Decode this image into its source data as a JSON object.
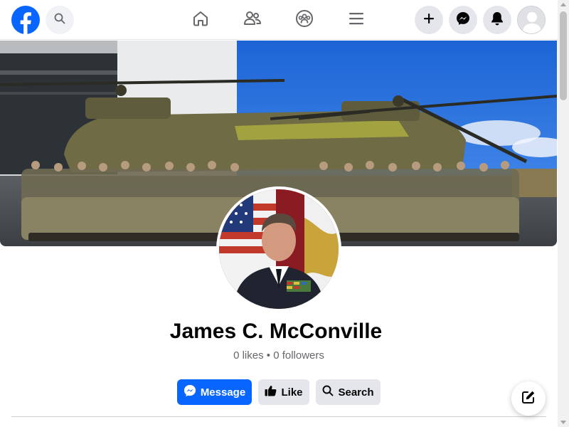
{
  "header": {
    "logo_icon": "facebook-logo-icon",
    "search_icon": "search-icon",
    "nav": [
      {
        "icon": "home-icon"
      },
      {
        "icon": "friends-icon"
      },
      {
        "icon": "groups-icon"
      },
      {
        "icon": "menu-icon"
      }
    ],
    "right": [
      {
        "icon": "plus-icon"
      },
      {
        "icon": "messenger-icon"
      },
      {
        "icon": "bell-icon"
      },
      {
        "icon": "profile-avatar-icon"
      }
    ]
  },
  "profile": {
    "name": "James C. McConville",
    "stats": "0 likes • 0 followers"
  },
  "actions": {
    "message_label": "Message",
    "like_label": "Like",
    "search_label": "Search"
  },
  "colors": {
    "brand_blue": "#0866ff",
    "secondary_bg": "#e4e6eb",
    "muted_text": "#65676b"
  }
}
